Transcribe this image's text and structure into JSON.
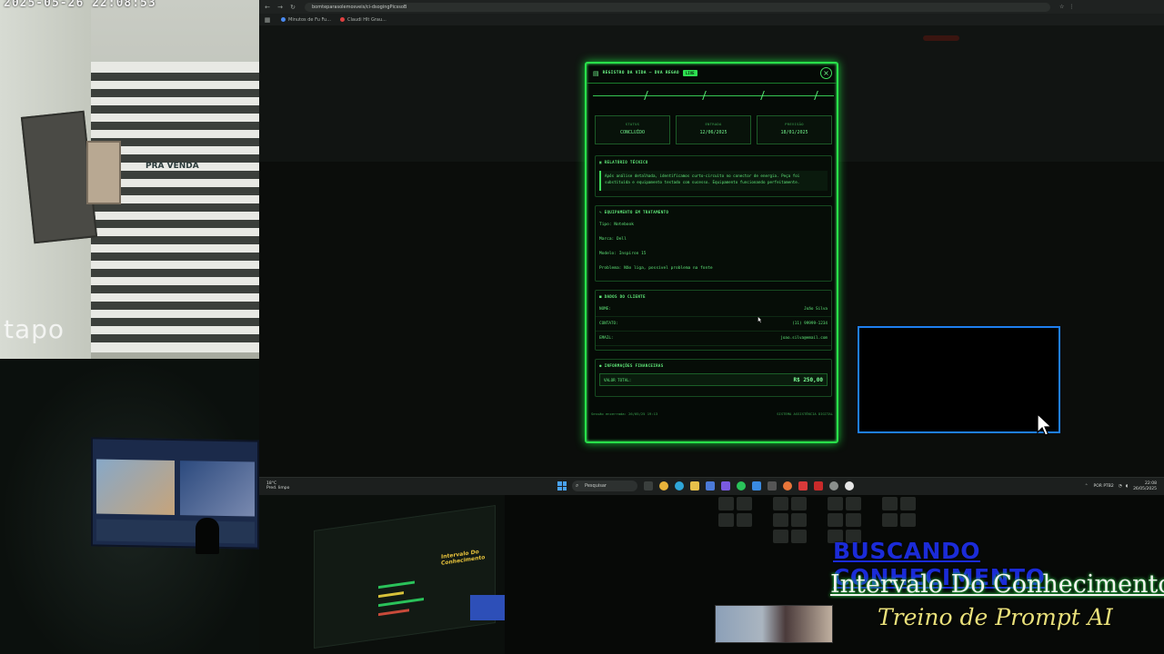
{
  "camera": {
    "timestamp": "2025-05-26 22:08:53",
    "logo": "tapo",
    "sign_text": "PRA VENDA"
  },
  "browser": {
    "url": "bomteparasolemosveis/ci-dsogingPicssoB",
    "bookmarks": [
      {
        "label": "Minutos de Fu Fu...",
        "color": "#4a8af0"
      },
      {
        "label": "Claudi Hlt Grau...",
        "color": "#e04040"
      }
    ]
  },
  "modal": {
    "title": "REGISTRO DA VIDA — DVA REGAO",
    "tag": "LIVE",
    "dates": [
      {
        "label": "STATUS",
        "value": "CONCLUÍDO"
      },
      {
        "label": "ENTRADA",
        "value": "12/06/2025"
      },
      {
        "label": "PREVISÃO",
        "value": "18/01/2025"
      }
    ],
    "report": {
      "title": "RELATÓRIO TÉCNICO",
      "text": "Após análise detalhada, identificamos curto-circuito no conector de energia. Peça foi substituída e equipamento testado com sucesso. Equipamento funcionando perfeitamente."
    },
    "equipment": {
      "title": "EQUIPAMENTO EM TRATAMENTO",
      "rows": [
        {
          "label": "Tipo:",
          "value": "Notebook"
        },
        {
          "label": "Marca:",
          "value": "Dell"
        },
        {
          "label": "Modelo:",
          "value": "Inspiron 15"
        },
        {
          "label": "Problema:",
          "value": "Não liga, possível problema na fonte"
        }
      ]
    },
    "client": {
      "title": "DADOS DO CLIENTE",
      "rows": [
        {
          "label": "NOME:",
          "value": "João Silva"
        },
        {
          "label": "CONTATO:",
          "value": "(11) 99999-1234"
        },
        {
          "label": "EMAIL:",
          "value": "joao.silva@email.com"
        }
      ]
    },
    "finance": {
      "title": "INFORMAÇÕES FINANCEIRAS",
      "label": "VALOR TOTAL:",
      "value": "R$ 250,00"
    },
    "footer_left": "Sessão encerrada: 26/05/25 19:13",
    "footer_right": "SISTEMA ASSISTÊNCIA DIGITAL"
  },
  "taskbar": {
    "weather_temp": "18°C",
    "weather_desc": "Pred. limpo",
    "search_placeholder": "Pesquisar",
    "lang": "POR PTB2",
    "time": "22:08",
    "date": "26/05/2025"
  },
  "overlay": {
    "line1": "BUSCANDO CONHECIMENTO",
    "line2": "Intervalo Do Conhecimento",
    "line3": "Treino de Prompt AI"
  },
  "studio": {
    "label": "Intervalo Do Conhecimento"
  }
}
